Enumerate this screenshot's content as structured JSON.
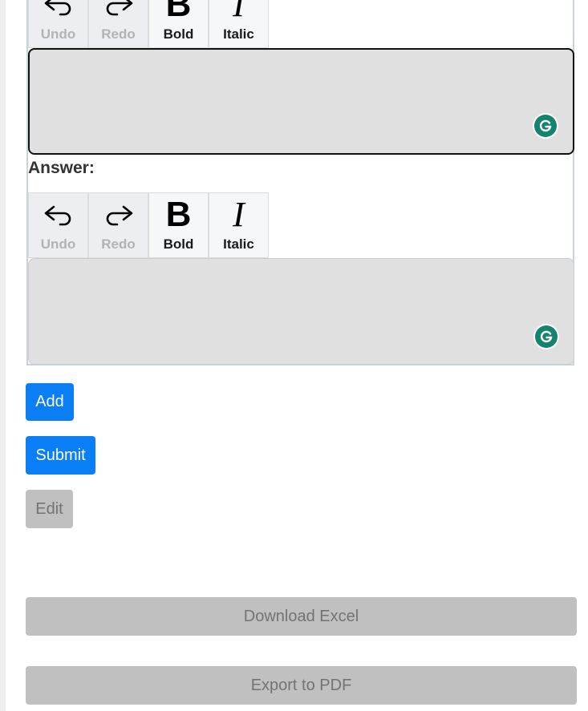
{
  "question_editor": {
    "toolbar": {
      "undo_label": "Undo",
      "redo_label": "Redo",
      "bold_label": "Bold",
      "bold_glyph": "B",
      "italic_label": "Italic",
      "italic_glyph": "I"
    },
    "value": ""
  },
  "answer_section": {
    "label": "Answer:",
    "toolbar": {
      "undo_label": "Undo",
      "redo_label": "Redo",
      "bold_label": "Bold",
      "bold_glyph": "B",
      "italic_label": "Italic",
      "italic_glyph": "I"
    },
    "value": ""
  },
  "actions": {
    "add_label": "Add",
    "submit_label": "Submit",
    "edit_label": "Edit",
    "download_excel_label": "Download Excel",
    "export_pdf_label": "Export to PDF"
  },
  "colors": {
    "primary": "#0a7ef5",
    "disabled": "#c0c0c0",
    "editor_bg": "#e0e0e0",
    "grammarly": "#15846f"
  },
  "icons": [
    "undo-icon",
    "redo-icon",
    "grammarly-icon"
  ]
}
